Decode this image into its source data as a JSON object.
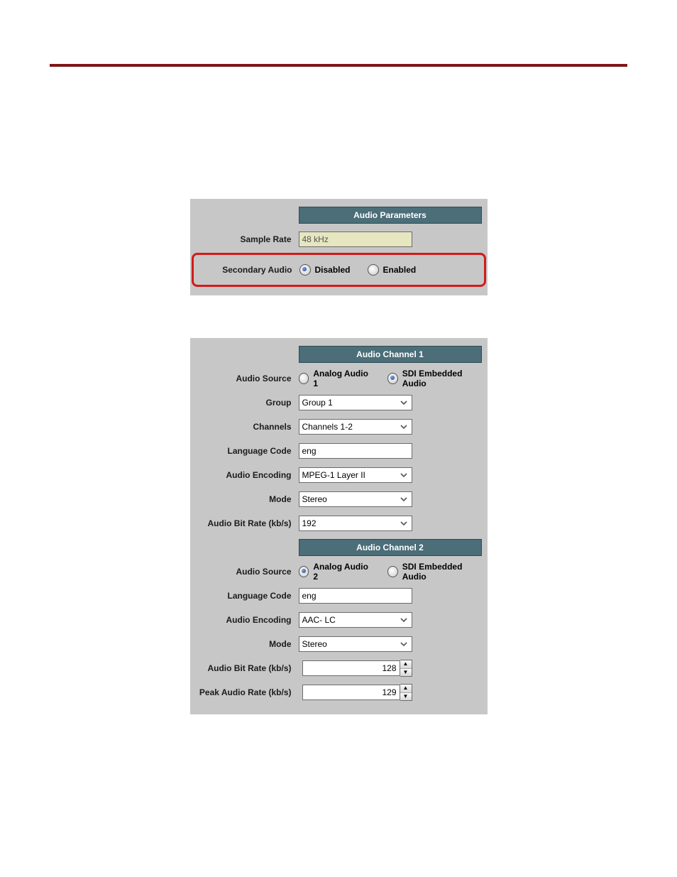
{
  "audio_parameters": {
    "header": "Audio Parameters",
    "sample_rate_label": "Sample Rate",
    "sample_rate_value": "48 kHz",
    "secondary_audio_label": "Secondary Audio",
    "secondary_audio_disabled": "Disabled",
    "secondary_audio_enabled": "Enabled"
  },
  "channel1": {
    "header": "Audio Channel 1",
    "audio_source_label": "Audio Source",
    "source_analog": "Analog Audio 1",
    "source_sdi": "SDI Embedded Audio",
    "group_label": "Group",
    "group_value": "Group 1",
    "channels_label": "Channels",
    "channels_value": "Channels 1-2",
    "language_label": "Language Code",
    "language_value": "eng",
    "encoding_label": "Audio Encoding",
    "encoding_value": "MPEG-1 Layer II",
    "mode_label": "Mode",
    "mode_value": "Stereo",
    "bitrate_label": "Audio Bit Rate (kb/s)",
    "bitrate_value": "192"
  },
  "channel2": {
    "header": "Audio Channel 2",
    "audio_source_label": "Audio Source",
    "source_analog": "Analog Audio 2",
    "source_sdi": "SDI Embedded Audio",
    "language_label": "Language Code",
    "language_value": "eng",
    "encoding_label": "Audio Encoding",
    "encoding_value": "AAC- LC",
    "mode_label": "Mode",
    "mode_value": "Stereo",
    "bitrate_label": "Audio Bit Rate (kb/s)",
    "bitrate_value": "128",
    "peakrate_label": "Peak Audio Rate (kb/s)",
    "peakrate_value": "129"
  }
}
